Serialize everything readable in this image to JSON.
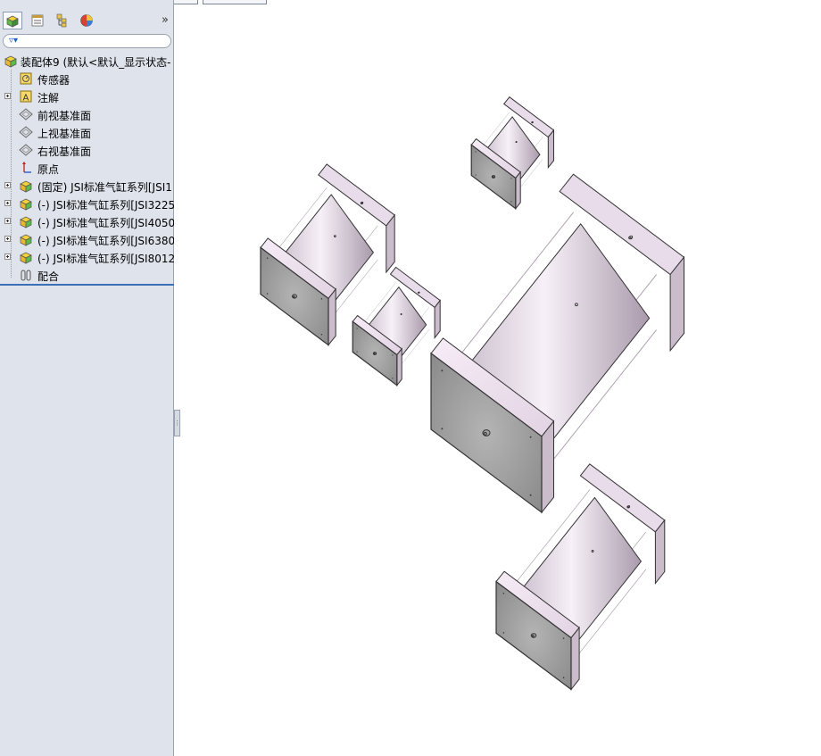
{
  "feature_tree": {
    "root": {
      "label": "装配体9  (默认<默认_显示状态-"
    },
    "items": [
      {
        "label": "传感器",
        "icon": "sensor-icon",
        "expandable": false
      },
      {
        "label": "注解",
        "icon": "annotation-icon",
        "expandable": true
      },
      {
        "label": "前视基准面",
        "icon": "plane-icon",
        "expandable": false
      },
      {
        "label": "上视基准面",
        "icon": "plane-icon",
        "expandable": false
      },
      {
        "label": "右视基准面",
        "icon": "plane-icon",
        "expandable": false
      },
      {
        "label": "原点",
        "icon": "origin-icon",
        "expandable": false
      },
      {
        "label": "(固定) JSI标准气缸系列[JSI1",
        "icon": "part-icon",
        "expandable": true
      },
      {
        "label": "(-) JSI标准气缸系列[JSI3225",
        "icon": "part-icon",
        "expandable": true
      },
      {
        "label": "(-) JSI标准气缸系列[JSI4050",
        "icon": "part-icon",
        "expandable": true
      },
      {
        "label": "(-) JSI标准气缸系列[JSI6380",
        "icon": "part-icon",
        "expandable": true
      },
      {
        "label": "(-) JSI标准气缸系列[JSI8012",
        "icon": "part-icon",
        "expandable": true
      },
      {
        "label": "配合",
        "icon": "mate-icon",
        "expandable": false
      }
    ]
  },
  "toolbar": {
    "tabs": [
      "feature-manager-icon",
      "property-manager-icon",
      "configuration-manager-icon",
      "display-manager-icon"
    ],
    "more_label": "»"
  },
  "colors": {
    "panel_bg": "#dfe3eb",
    "accent": "#3b6fb6",
    "part_face": "#f3e8f4",
    "part_edge": "#333333"
  }
}
